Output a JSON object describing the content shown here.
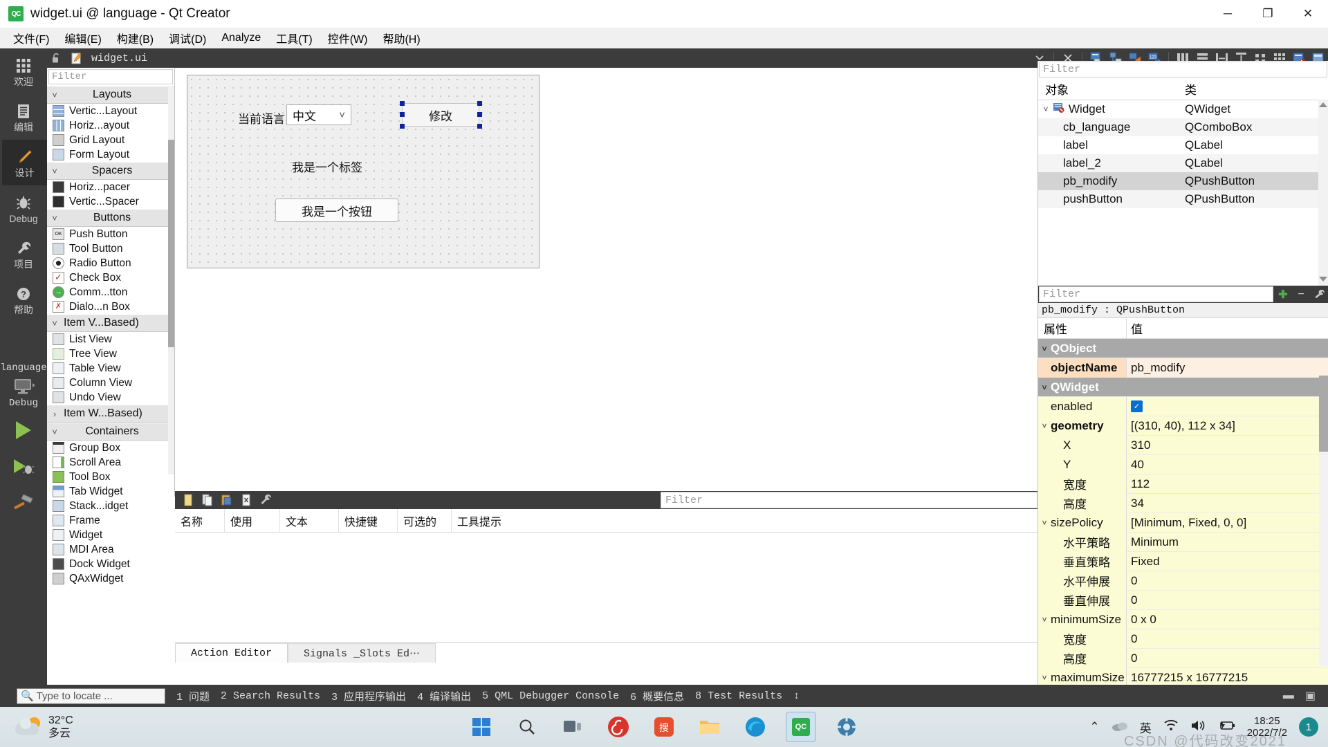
{
  "titlebar": {
    "app_icon": "qt-creator-icon",
    "title": "widget.ui @ language - Qt Creator",
    "minimize": "─",
    "maximize": "❐",
    "close": "✕"
  },
  "menubar": {
    "items": [
      {
        "label": "文件(F)"
      },
      {
        "label": "编辑(E)"
      },
      {
        "label": "构建(B)"
      },
      {
        "label": "调试(D)"
      },
      {
        "label": "Analyze"
      },
      {
        "label": "工具(T)"
      },
      {
        "label": "控件(W)"
      },
      {
        "label": "帮助(H)"
      }
    ]
  },
  "modebar": {
    "modes": [
      {
        "label": "欢迎",
        "icon": "grid-icon"
      },
      {
        "label": "编辑",
        "icon": "document-icon"
      },
      {
        "label": "设计",
        "icon": "pencil-icon"
      },
      {
        "label": "Debug",
        "icon": "bug-icon"
      },
      {
        "label": "项目",
        "icon": "wrench-icon"
      },
      {
        "label": "帮助",
        "icon": "question-icon"
      }
    ],
    "kit_name": "language",
    "build_config": "Debug",
    "run_label": "run-button",
    "debug_label": "debug-button",
    "build_label": "build-button"
  },
  "doc_toolbar": {
    "filename": "widget.ui",
    "lock_icon": "unlock-icon",
    "file_icon": "ui-file-icon",
    "dropdown_icon": "chevron-down-icon",
    "close_icon": "close-icon",
    "tools": [
      "edit-widgets-icon",
      "edit-signals-slots-icon",
      "edit-buddies-icon",
      "edit-tab-order-icon",
      "layout-horizontally-icon",
      "layout-vertically-icon",
      "layout-splitter-h-icon",
      "layout-splitter-v-icon",
      "layout-form-icon",
      "layout-grid-icon",
      "break-layout-icon",
      "adjust-size-icon"
    ]
  },
  "widget_box": {
    "filter_placeholder": "Filter",
    "groups": [
      {
        "name": "Layouts",
        "expanded": true,
        "items": [
          {
            "label": "Vertic...Layout",
            "icon": "vertical-layout-icon"
          },
          {
            "label": "Horiz...ayout",
            "icon": "horizontal-layout-icon"
          },
          {
            "label": "Grid Layout",
            "icon": "grid-layout-icon"
          },
          {
            "label": "Form Layout",
            "icon": "form-layout-icon"
          }
        ]
      },
      {
        "name": "Spacers",
        "expanded": true,
        "items": [
          {
            "label": "Horiz...pacer",
            "icon": "horizontal-spacer-icon"
          },
          {
            "label": "Vertic...Spacer",
            "icon": "vertical-spacer-icon"
          }
        ]
      },
      {
        "name": "Buttons",
        "expanded": true,
        "items": [
          {
            "label": "Push Button",
            "icon": "push-button-icon"
          },
          {
            "label": "Tool Button",
            "icon": "tool-button-icon"
          },
          {
            "label": "Radio Button",
            "icon": "radio-button-icon"
          },
          {
            "label": "Check Box",
            "icon": "check-box-icon"
          },
          {
            "label": "Comm...tton",
            "icon": "command-link-button-icon"
          },
          {
            "label": "Dialo...n Box",
            "icon": "dialog-button-box-icon"
          }
        ]
      },
      {
        "name": "Item V...Based)",
        "expanded": true,
        "items": [
          {
            "label": "List View",
            "icon": "list-view-icon"
          },
          {
            "label": "Tree View",
            "icon": "tree-view-icon"
          },
          {
            "label": "Table View",
            "icon": "table-view-icon"
          },
          {
            "label": "Column View",
            "icon": "column-view-icon"
          },
          {
            "label": "Undo View",
            "icon": "undo-view-icon"
          }
        ]
      },
      {
        "name": "Item W...Based)",
        "expanded": false,
        "items": []
      },
      {
        "name": "Containers",
        "expanded": true,
        "items": [
          {
            "label": "Group Box",
            "icon": "group-box-icon"
          },
          {
            "label": "Scroll Area",
            "icon": "scroll-area-icon"
          },
          {
            "label": "Tool Box",
            "icon": "tool-box-icon"
          },
          {
            "label": "Tab Widget",
            "icon": "tab-widget-icon"
          },
          {
            "label": "Stack...idget",
            "icon": "stacked-widget-icon"
          },
          {
            "label": "Frame",
            "icon": "frame-icon"
          },
          {
            "label": "Widget",
            "icon": "widget-icon"
          },
          {
            "label": "MDI Area",
            "icon": "mdi-area-icon"
          },
          {
            "label": "Dock Widget",
            "icon": "dock-widget-icon"
          },
          {
            "label": "QAxWidget",
            "icon": "qax-widget-icon"
          }
        ]
      }
    ]
  },
  "form": {
    "label_language": "当前语言：",
    "combo_value": "中文",
    "combo_arrow": "⌄",
    "button_modify": "修改",
    "label_center": "我是一个标签",
    "button_sample": "我是一个按钮"
  },
  "action_editor": {
    "filter_placeholder": "Filter",
    "toolbar_icons": [
      "new-action-icon",
      "copy-icon",
      "paste-icon",
      "delete-icon",
      "settings-icon"
    ],
    "columns": [
      "名称",
      "使用",
      "文本",
      "快捷键",
      "可选的",
      "工具提示"
    ],
    "rows": [],
    "tabs": [
      {
        "label": "Action Editor",
        "active": true
      },
      {
        "label": "Signals _Slots Ed⋯",
        "active": false
      }
    ]
  },
  "object_inspector": {
    "filter_placeholder": "Filter",
    "columns": [
      "对象",
      "类"
    ],
    "rows": [
      {
        "object": "Widget",
        "class": "QWidget",
        "level": 0,
        "expanded": true,
        "selected": false,
        "icon": "widget-node-icon"
      },
      {
        "object": "cb_language",
        "class": "QComboBox",
        "level": 1,
        "selected": false
      },
      {
        "object": "label",
        "class": "QLabel",
        "level": 1,
        "selected": false
      },
      {
        "object": "label_2",
        "class": "QLabel",
        "level": 1,
        "selected": false
      },
      {
        "object": "pb_modify",
        "class": "QPushButton",
        "level": 1,
        "selected": true
      },
      {
        "object": "pushButton",
        "class": "QPushButton",
        "level": 1,
        "selected": false
      }
    ]
  },
  "property_editor": {
    "filter_placeholder": "Filter",
    "add_icon": "plus-icon",
    "remove_icon": "minus-icon",
    "config_icon": "wrench-icon",
    "object_line": "pb_modify : QPushButton",
    "columns": [
      "属性",
      "值"
    ],
    "rows": [
      {
        "name": "QObject",
        "value": "",
        "type": "group",
        "level": 0
      },
      {
        "name": "objectName",
        "value": "pb_modify",
        "type": "peach",
        "level": 1
      },
      {
        "name": "QWidget",
        "value": "",
        "type": "group",
        "level": 0
      },
      {
        "name": "enabled",
        "value": "",
        "type": "check",
        "level": 1
      },
      {
        "name": "geometry",
        "value": "[(310, 40), 112 x 34]",
        "type": "parent",
        "level": 0
      },
      {
        "name": "X",
        "value": "310",
        "type": "yellow",
        "level": 2
      },
      {
        "name": "Y",
        "value": "40",
        "type": "yellow",
        "level": 2
      },
      {
        "name": "宽度",
        "value": "112",
        "type": "yellow",
        "level": 2
      },
      {
        "name": "高度",
        "value": "34",
        "type": "yellow",
        "level": 2
      },
      {
        "name": "sizePolicy",
        "value": "[Minimum, Fixed, 0, 0]",
        "type": "parent",
        "level": 0
      },
      {
        "name": "水平策略",
        "value": "Minimum",
        "type": "yellow",
        "level": 2
      },
      {
        "name": "垂直策略",
        "value": "Fixed",
        "type": "yellow",
        "level": 2
      },
      {
        "name": "水平伸展",
        "value": "0",
        "type": "yellow",
        "level": 2
      },
      {
        "name": "垂直伸展",
        "value": "0",
        "type": "yellow",
        "level": 2
      },
      {
        "name": "minimumSize",
        "value": "0 x 0",
        "type": "parent",
        "level": 0
      },
      {
        "name": "宽度",
        "value": "0",
        "type": "yellow",
        "level": 2
      },
      {
        "name": "高度",
        "value": "0",
        "type": "yellow",
        "level": 2
      },
      {
        "name": "maximumSize",
        "value": "16777215 x 16777215",
        "type": "parent",
        "level": 0
      }
    ]
  },
  "statusbar": {
    "locate_placeholder": "Type to locate ...",
    "search_icon": "search-icon",
    "items": [
      "1 问题",
      "2 Search Results",
      "3 应用程序输出",
      "4 编译输出",
      "5 QML Debugger Console",
      "6 概要信息",
      "8 Test Results"
    ],
    "updown_icon": "up-down-arrow-icon"
  },
  "taskbar": {
    "weather_temp": "32°C",
    "weather_desc": "多云",
    "weather_icon": "partly-cloudy-icon",
    "apps": [
      {
        "name": "start-button",
        "icon": "windows-logo-icon"
      },
      {
        "name": "search-button",
        "icon": "search-icon"
      },
      {
        "name": "task-view-button",
        "icon": "task-view-icon"
      },
      {
        "name": "app-netease-music",
        "icon": "netease-music-icon"
      },
      {
        "name": "app-sogou-input",
        "icon": "sogou-icon"
      },
      {
        "name": "app-file-explorer",
        "icon": "folder-icon"
      },
      {
        "name": "app-edge",
        "icon": "edge-icon"
      },
      {
        "name": "app-qt-creator",
        "icon": "qt-creator-icon"
      },
      {
        "name": "app-settings",
        "icon": "gear-icon"
      }
    ],
    "tray": {
      "overflow": "⌃",
      "cloud_icon": "onedrive-icon",
      "ime": "英",
      "wifi_icon": "wifi-icon",
      "volume_icon": "volume-icon",
      "battery_icon": "battery-charging-icon",
      "time": "18:25",
      "date": "2022/7/2",
      "notification_count": "1"
    },
    "watermark": "CSDN @代码改变2021"
  }
}
